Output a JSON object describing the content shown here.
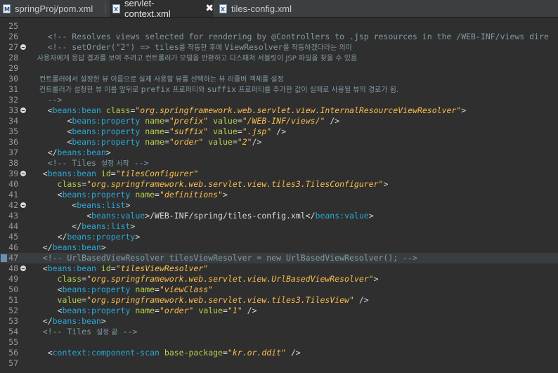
{
  "tabs": [
    {
      "label": "springProj/pom.xml",
      "icon": "maven-file-icon"
    },
    {
      "label": "servlet-context.xml",
      "icon": "xml-file-icon",
      "active": true
    },
    {
      "label": "tiles-config.xml",
      "icon": "xml-file-icon"
    }
  ],
  "close_symbol": "✖",
  "lines": [
    {
      "n": "25",
      "fold": false,
      "tokens": []
    },
    {
      "n": "26",
      "fold": false,
      "tokens": [
        {
          "t": "c",
          "s": "    <!-- Resolves views selected for rendering by @Controllers to .jsp resources in the /WEB-INF/views dire"
        }
      ]
    },
    {
      "n": "27",
      "fold": true,
      "tokens": [
        {
          "t": "c",
          "s": "    <!-- setOrder(\"2\") => tiles"
        },
        {
          "t": "c ko",
          "s": "를 작동한 후에 "
        },
        {
          "t": "c",
          "s": "ViewResolver"
        },
        {
          "t": "c ko",
          "s": "를 작동하겠다라는 의미"
        }
      ]
    },
    {
      "n": "28",
      "fold": false,
      "tokens": [
        {
          "t": "c ko",
          "s": "    사용자에게 응답 결과를 보여 주려고 컨트롤러가 모델을 반환하고 디스패쳐 서블릿이 JSP 파일을 찾을 수 있음"
        }
      ]
    },
    {
      "n": "29",
      "fold": false,
      "tokens": []
    },
    {
      "n": "30",
      "fold": false,
      "tokens": [
        {
          "t": "c ko",
          "s": "     컨트롤러에서 설정한 뷰 이름으로 실제 사용할 뷰를 선택하는 뷰 리졸버 객체를 설정"
        }
      ]
    },
    {
      "n": "31",
      "fold": false,
      "tokens": [
        {
          "t": "c ko",
          "s": "     컨트롤러가 설정한 뷰 이름 앞뒤로 "
        },
        {
          "t": "c",
          "s": "prefix"
        },
        {
          "t": "c ko",
          "s": " 프로퍼티와 "
        },
        {
          "t": "c",
          "s": "suffix"
        },
        {
          "t": "c ko",
          "s": " 프로퍼티를 추가한 값이 실제로 사용될 뷰의 경로가 됨."
        }
      ]
    },
    {
      "n": "32",
      "fold": false,
      "tokens": [
        {
          "t": "c",
          "s": "    -->"
        }
      ]
    },
    {
      "n": "33",
      "fold": true,
      "tokens": [
        {
          "t": "b",
          "s": "    <"
        },
        {
          "t": "t",
          "s": "beans:bean"
        },
        {
          "t": "p",
          "s": " "
        },
        {
          "t": "a",
          "s": "class"
        },
        {
          "t": "p",
          "s": "="
        },
        {
          "t": "v",
          "s": "\"org.springframework.web.servlet.view.InternalResourceViewResolver\""
        },
        {
          "t": "b",
          "s": ">"
        }
      ]
    },
    {
      "n": "34",
      "fold": false,
      "tokens": [
        {
          "t": "b",
          "s": "        <"
        },
        {
          "t": "t",
          "s": "beans:property"
        },
        {
          "t": "p",
          "s": " "
        },
        {
          "t": "a",
          "s": "name"
        },
        {
          "t": "p",
          "s": "="
        },
        {
          "t": "v",
          "s": "\"prefix\""
        },
        {
          "t": "p",
          "s": " "
        },
        {
          "t": "a",
          "s": "value"
        },
        {
          "t": "p",
          "s": "="
        },
        {
          "t": "v",
          "s": "\"/WEB-INF/views/\""
        },
        {
          "t": "b",
          "s": " />"
        }
      ]
    },
    {
      "n": "35",
      "fold": false,
      "tokens": [
        {
          "t": "b",
          "s": "        <"
        },
        {
          "t": "t",
          "s": "beans:property"
        },
        {
          "t": "p",
          "s": " "
        },
        {
          "t": "a",
          "s": "name"
        },
        {
          "t": "p",
          "s": "="
        },
        {
          "t": "v",
          "s": "\"suffix\""
        },
        {
          "t": "p",
          "s": " "
        },
        {
          "t": "a",
          "s": "value"
        },
        {
          "t": "p",
          "s": "="
        },
        {
          "t": "v",
          "s": "\".jsp\""
        },
        {
          "t": "b",
          "s": " />"
        }
      ]
    },
    {
      "n": "36",
      "fold": false,
      "tokens": [
        {
          "t": "b",
          "s": "        <"
        },
        {
          "t": "t",
          "s": "beans:property"
        },
        {
          "t": "p",
          "s": " "
        },
        {
          "t": "a",
          "s": "name"
        },
        {
          "t": "p",
          "s": "="
        },
        {
          "t": "v",
          "s": "\"order\""
        },
        {
          "t": "p",
          "s": " "
        },
        {
          "t": "a",
          "s": "value"
        },
        {
          "t": "p",
          "s": "="
        },
        {
          "t": "v",
          "s": "\"2\""
        },
        {
          "t": "b",
          "s": "/>"
        }
      ]
    },
    {
      "n": "37",
      "fold": false,
      "tokens": [
        {
          "t": "b",
          "s": "    </"
        },
        {
          "t": "t",
          "s": "beans:bean"
        },
        {
          "t": "b",
          "s": ">"
        }
      ]
    },
    {
      "n": "38",
      "fold": false,
      "tokens": [
        {
          "t": "c",
          "s": "    <!-- Tiles "
        },
        {
          "t": "c ko",
          "s": "설정 시작"
        },
        {
          "t": "c",
          "s": " -->"
        }
      ]
    },
    {
      "n": "39",
      "fold": true,
      "tokens": [
        {
          "t": "b",
          "s": "   <"
        },
        {
          "t": "t",
          "s": "beans:bean"
        },
        {
          "t": "p",
          "s": " "
        },
        {
          "t": "a",
          "s": "id"
        },
        {
          "t": "p",
          "s": "="
        },
        {
          "t": "v",
          "s": "\"tilesConfigurer\""
        }
      ]
    },
    {
      "n": "40",
      "fold": false,
      "tokens": [
        {
          "t": "a",
          "s": "      class"
        },
        {
          "t": "p",
          "s": "="
        },
        {
          "t": "v",
          "s": "\"org.springframework.web.servlet.view.tiles3.TilesConfigurer\""
        },
        {
          "t": "b",
          "s": ">"
        }
      ]
    },
    {
      "n": "41",
      "fold": false,
      "tokens": [
        {
          "t": "b",
          "s": "      <"
        },
        {
          "t": "t",
          "s": "beans:property"
        },
        {
          "t": "p",
          "s": " "
        },
        {
          "t": "a",
          "s": "name"
        },
        {
          "t": "p",
          "s": "="
        },
        {
          "t": "v",
          "s": "\"definitions\""
        },
        {
          "t": "b",
          "s": ">"
        }
      ]
    },
    {
      "n": "42",
      "fold": true,
      "tokens": [
        {
          "t": "b",
          "s": "         <"
        },
        {
          "t": "t",
          "s": "beans:list"
        },
        {
          "t": "b",
          "s": ">"
        }
      ]
    },
    {
      "n": "43",
      "fold": false,
      "tokens": [
        {
          "t": "b",
          "s": "            <"
        },
        {
          "t": "t",
          "s": "beans:value"
        },
        {
          "t": "b",
          "s": ">/WEB-INF/spring/tiles-config.xml</"
        },
        {
          "t": "t",
          "s": "beans:value"
        },
        {
          "t": "b",
          "s": ">"
        }
      ]
    },
    {
      "n": "44",
      "fold": false,
      "tokens": [
        {
          "t": "b",
          "s": "         </"
        },
        {
          "t": "t",
          "s": "beans:list"
        },
        {
          "t": "b",
          "s": ">"
        }
      ]
    },
    {
      "n": "45",
      "fold": false,
      "tokens": [
        {
          "t": "b",
          "s": "      </"
        },
        {
          "t": "t",
          "s": "beans:property"
        },
        {
          "t": "b",
          "s": ">"
        }
      ]
    },
    {
      "n": "46",
      "fold": false,
      "tokens": [
        {
          "t": "b",
          "s": "   </"
        },
        {
          "t": "t",
          "s": "beans:bean"
        },
        {
          "t": "b",
          "s": ">"
        }
      ]
    },
    {
      "n": "47",
      "fold": false,
      "bookmark": true,
      "highlight": true,
      "tokens": [
        {
          "t": "c",
          "s": "   <!-- UrlBasedViewResolver tilesViewResolver = new UrlBasedViewResolver(); -->"
        }
      ]
    },
    {
      "n": "48",
      "fold": true,
      "tokens": [
        {
          "t": "b",
          "s": "   <"
        },
        {
          "t": "t",
          "s": "beans:bean"
        },
        {
          "t": "p",
          "s": " "
        },
        {
          "t": "a",
          "s": "id"
        },
        {
          "t": "p",
          "s": "="
        },
        {
          "t": "v",
          "s": "\"tilesViewResolver\""
        }
      ]
    },
    {
      "n": "49",
      "fold": false,
      "tokens": [
        {
          "t": "a",
          "s": "      class"
        },
        {
          "t": "p",
          "s": "="
        },
        {
          "t": "v",
          "s": "\"org.springframework.web.servlet.view.UrlBasedViewResolver\""
        },
        {
          "t": "b",
          "s": ">"
        }
      ]
    },
    {
      "n": "50",
      "fold": false,
      "tokens": [
        {
          "t": "b",
          "s": "      <"
        },
        {
          "t": "t",
          "s": "beans:property"
        },
        {
          "t": "p",
          "s": " "
        },
        {
          "t": "a",
          "s": "name"
        },
        {
          "t": "p",
          "s": "="
        },
        {
          "t": "v",
          "s": "\"viewClass\""
        }
      ]
    },
    {
      "n": "51",
      "fold": false,
      "tokens": [
        {
          "t": "a",
          "s": "      value"
        },
        {
          "t": "p",
          "s": "="
        },
        {
          "t": "v",
          "s": "\"org.springframework.web.servlet.view.tiles3.TilesView\""
        },
        {
          "t": "b",
          "s": " />"
        }
      ]
    },
    {
      "n": "52",
      "fold": false,
      "tokens": [
        {
          "t": "b",
          "s": "      <"
        },
        {
          "t": "t",
          "s": "beans:property"
        },
        {
          "t": "p",
          "s": " "
        },
        {
          "t": "a",
          "s": "name"
        },
        {
          "t": "p",
          "s": "="
        },
        {
          "t": "v",
          "s": "\"order\""
        },
        {
          "t": "p",
          "s": " "
        },
        {
          "t": "a",
          "s": "value"
        },
        {
          "t": "p",
          "s": "="
        },
        {
          "t": "v",
          "s": "\"1\""
        },
        {
          "t": "b",
          "s": " />"
        }
      ]
    },
    {
      "n": "53",
      "fold": false,
      "tokens": [
        {
          "t": "b",
          "s": "   </"
        },
        {
          "t": "t",
          "s": "beans:bean"
        },
        {
          "t": "b",
          "s": ">"
        }
      ]
    },
    {
      "n": "54",
      "fold": false,
      "tokens": [
        {
          "t": "c",
          "s": "   <!-- Tiles "
        },
        {
          "t": "c ko",
          "s": "설정 끝"
        },
        {
          "t": "c",
          "s": " -->"
        }
      ]
    },
    {
      "n": "55",
      "fold": false,
      "tokens": []
    },
    {
      "n": "56",
      "fold": false,
      "tokens": [
        {
          "t": "b",
          "s": "    <"
        },
        {
          "t": "t",
          "s": "context:component-scan"
        },
        {
          "t": "p",
          "s": " "
        },
        {
          "t": "a",
          "s": "base-package"
        },
        {
          "t": "p",
          "s": "="
        },
        {
          "t": "v",
          "s": "\"kr.or.ddit\""
        },
        {
          "t": "b",
          "s": " />"
        }
      ]
    },
    {
      "n": "57",
      "fold": false,
      "tokens": []
    }
  ]
}
